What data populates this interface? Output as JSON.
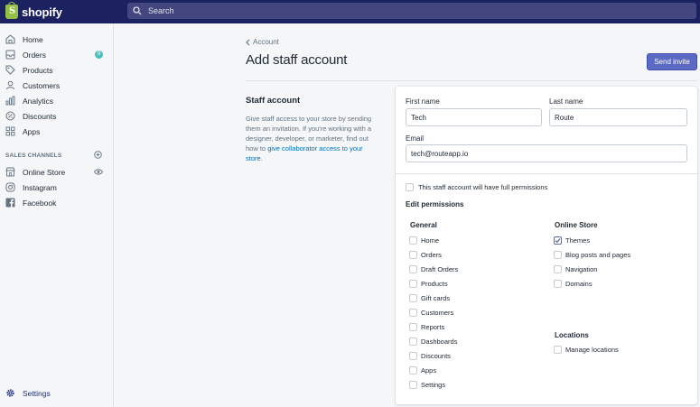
{
  "brand": {
    "name": "shopify"
  },
  "search": {
    "placeholder": "Search"
  },
  "sidebar": {
    "items": [
      {
        "label": "Home",
        "icon": "home-icon"
      },
      {
        "label": "Orders",
        "icon": "orders-icon",
        "badge": "9"
      },
      {
        "label": "Products",
        "icon": "tag-icon"
      },
      {
        "label": "Customers",
        "icon": "person-icon"
      },
      {
        "label": "Analytics",
        "icon": "chart-icon"
      },
      {
        "label": "Discounts",
        "icon": "discount-icon"
      },
      {
        "label": "Apps",
        "icon": "apps-icon"
      }
    ],
    "sales_channels_label": "SALES CHANNELS",
    "channels": [
      {
        "label": "Online Store",
        "icon": "store-icon"
      },
      {
        "label": "Instagram",
        "icon": "instagram-icon"
      },
      {
        "label": "Facebook",
        "icon": "facebook-icon"
      }
    ],
    "settings_label": "Settings"
  },
  "page": {
    "back_label": "Account",
    "title": "Add staff account",
    "send_invite": "Send invite"
  },
  "staff_section": {
    "title": "Staff account",
    "description": "Give staff access to your store by sending them an invitation. If you're working with a designer, developer, or marketer, find out how to ",
    "link": "give collaborator access to your store",
    "end": "."
  },
  "form": {
    "first_name_label": "First name",
    "first_name_value": "Tech",
    "last_name_label": "Last name",
    "last_name_value": "Route",
    "email_label": "Email",
    "email_value": "tech@routeapp.io",
    "full_permissions_label": "This staff account will have full permissions",
    "edit_permissions_title": "Edit permissions"
  },
  "permissions": {
    "general_title": "General",
    "general": [
      {
        "label": "Home",
        "checked": false
      },
      {
        "label": "Orders",
        "checked": false
      },
      {
        "label": "Draft Orders",
        "checked": false
      },
      {
        "label": "Products",
        "checked": false
      },
      {
        "label": "Gift cards",
        "checked": false
      },
      {
        "label": "Customers",
        "checked": false
      },
      {
        "label": "Reports",
        "checked": false
      },
      {
        "label": "Dashboards",
        "checked": false
      },
      {
        "label": "Discounts",
        "checked": false
      },
      {
        "label": "Apps",
        "checked": false
      },
      {
        "label": "Settings",
        "checked": false
      }
    ],
    "online_store_title": "Online Store",
    "online_store": [
      {
        "label": "Themes",
        "checked": true
      },
      {
        "label": "Blog posts and pages",
        "checked": false
      },
      {
        "label": "Navigation",
        "checked": false
      },
      {
        "label": "Domains",
        "checked": false
      }
    ],
    "locations_title": "Locations",
    "locations": [
      {
        "label": "Manage locations",
        "checked": false
      }
    ]
  },
  "colors": {
    "topbar": "#1c2260",
    "accent": "#5c6ac4",
    "link": "#006fbb",
    "badge": "#47c1bf",
    "logo": "#95bf47"
  }
}
